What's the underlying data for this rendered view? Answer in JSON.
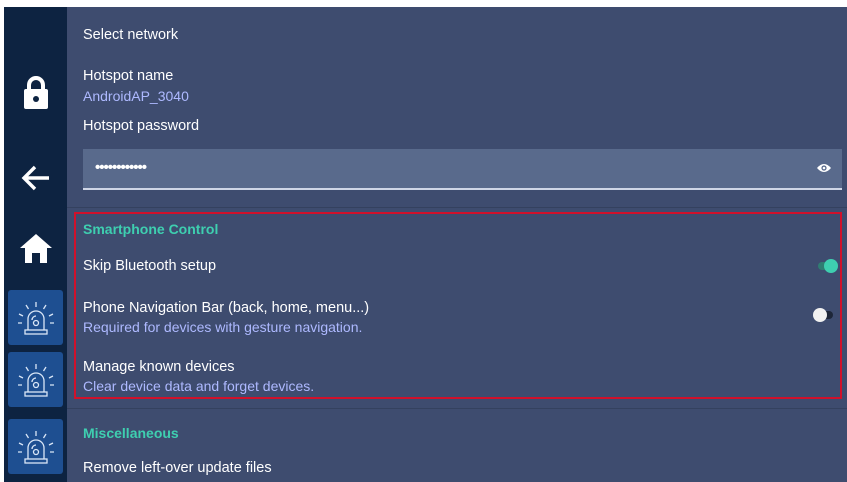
{
  "sidebar": {
    "items": [
      {
        "icon": "lock-icon"
      },
      {
        "icon": "arrow-back-icon"
      },
      {
        "icon": "home-icon"
      },
      {
        "icon": "siren-icon"
      },
      {
        "icon": "siren-icon"
      },
      {
        "icon": "siren-icon"
      }
    ]
  },
  "settings": {
    "select_network": "Select network",
    "hotspot_name_label": "Hotspot name",
    "hotspot_name_value": "AndroidAP_3040",
    "hotspot_password_label": "Hotspot password",
    "hotspot_password_value": "••••••••••••",
    "smartphone_section": "Smartphone Control",
    "skip_bluetooth_label": "Skip Bluetooth setup",
    "skip_bluetooth_on": true,
    "phone_nav_label": "Phone Navigation Bar (back, home, menu...)",
    "phone_nav_sub": "Required for devices with gesture navigation.",
    "phone_nav_on": false,
    "manage_devices_label": "Manage known devices",
    "manage_devices_sub": "Clear device data and forget devices.",
    "misc_section": "Miscellaneous",
    "remove_files_label": "Remove left-over update files"
  },
  "colors": {
    "accent": "#3ecfb0",
    "highlight": "#d0112b",
    "subtitle": "#aeb9ff",
    "background": "#3e4c6f",
    "sidebar": "#0d2341"
  }
}
